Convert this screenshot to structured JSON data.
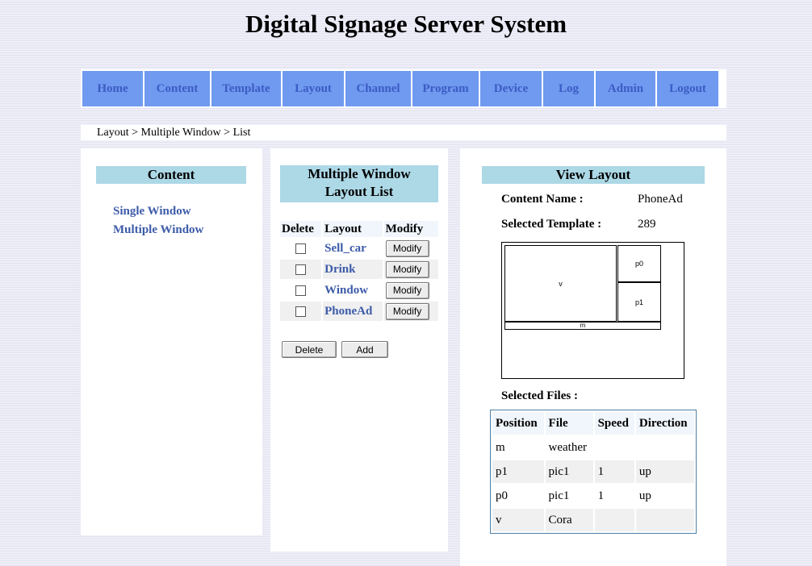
{
  "site": {
    "title": "Digital Signage Server System"
  },
  "nav": [
    {
      "label": "Home"
    },
    {
      "label": "Content"
    },
    {
      "label": "Template"
    },
    {
      "label": "Layout"
    },
    {
      "label": "Channel"
    },
    {
      "label": "Program"
    },
    {
      "label": "Device"
    },
    {
      "label": "Log"
    },
    {
      "label": "Admin"
    },
    {
      "label": "Logout"
    }
  ],
  "breadcrumb": "Layout > Multiple Window > List",
  "content_panel": {
    "title": "Content",
    "links": [
      "Single Window",
      "Multiple Window"
    ]
  },
  "layout_list": {
    "title_line1": "Multiple Window",
    "title_line2": "Layout List",
    "headers": {
      "delete": "Delete",
      "layout": "Layout",
      "modify": "Modify"
    },
    "rows": [
      {
        "name": "Sell_car",
        "modify_label": "Modify"
      },
      {
        "name": "Drink",
        "modify_label": "Modify"
      },
      {
        "name": "Window",
        "modify_label": "Modify"
      },
      {
        "name": "PhoneAd",
        "modify_label": "Modify"
      }
    ],
    "delete_label": "Delete",
    "add_label": "Add"
  },
  "view_layout": {
    "title": "View Layout",
    "content_name_label": "Content Name :",
    "content_name_value": "PhoneAd",
    "template_label": "Selected Template :",
    "template_value": "289",
    "regions": {
      "v": "v",
      "p0": "p0",
      "p1": "p1",
      "m": "m"
    },
    "files_label": "Selected Files :",
    "files_headers": {
      "position": "Position",
      "file": "File",
      "speed": "Speed",
      "direction": "Direction"
    },
    "files": [
      {
        "position": "m",
        "file": "weather",
        "speed": "",
        "direction": ""
      },
      {
        "position": "p1",
        "file": "pic1",
        "speed": "1",
        "direction": "up"
      },
      {
        "position": "p0",
        "file": "pic1",
        "speed": "1",
        "direction": "up"
      },
      {
        "position": "v",
        "file": "Cora",
        "speed": "",
        "direction": ""
      }
    ]
  }
}
